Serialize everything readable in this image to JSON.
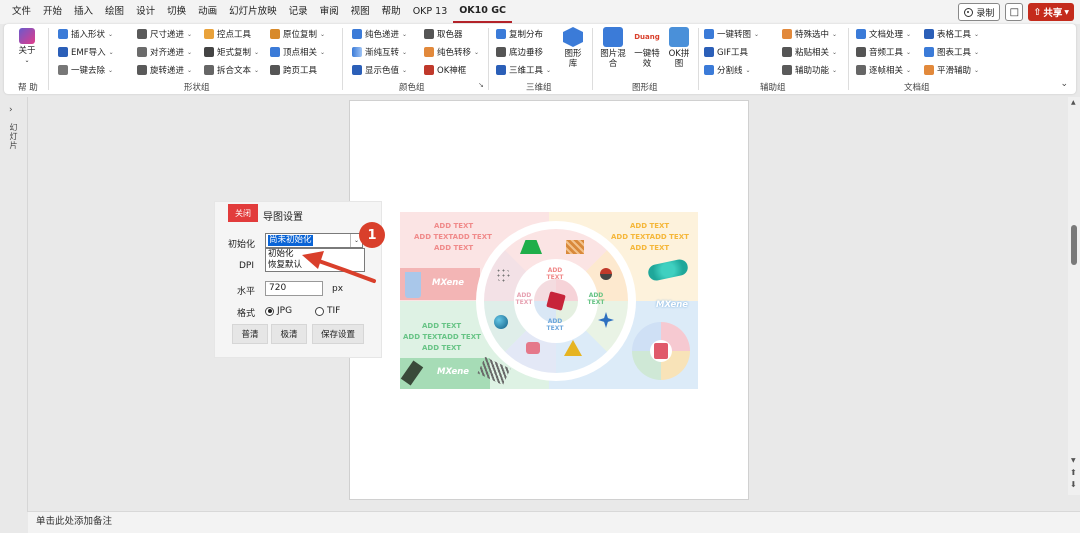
{
  "menubar": {
    "tabs": [
      "文件",
      "开始",
      "插入",
      "绘图",
      "设计",
      "切换",
      "动画",
      "幻灯片放映",
      "记录",
      "审阅",
      "视图",
      "帮助",
      "OKP 13",
      "OK10 GC"
    ],
    "active_tab": "OK10 GC",
    "record_label": "录制",
    "share_label": "共享"
  },
  "ribbon": {
    "help": {
      "about_label": "关于",
      "group_label": "帮 助"
    },
    "shape_group": {
      "label": "形状组",
      "items": [
        "插入形状",
        "尺寸递进",
        "控点工具",
        "原位复制",
        "EMF导入",
        "对齐递进",
        "矩式复制",
        "顶点相关",
        "一键去除",
        "旋转递进",
        "拆合文本",
        "跨页工具"
      ]
    },
    "color_group": {
      "label": "颜色组",
      "items": [
        "纯色递进",
        "取色器",
        "渐纯互转",
        "纯色转移",
        "显示色值",
        "OK神框"
      ]
    },
    "three_d_group": {
      "label": "三维组",
      "items": [
        "复制分布",
        "底边垂移",
        "三维工具"
      ],
      "big_label": "图形库"
    },
    "graphics_group": {
      "label": "图形组",
      "big_buttons": [
        "图片混合",
        "一键特效",
        "OK拼图"
      ],
      "duang_text": "Duang"
    },
    "aux_group": {
      "label": "辅助组",
      "items": [
        "一键转图",
        "特殊选中",
        "GIF工具",
        "粘贴相关",
        "分割线",
        "辅助功能"
      ]
    },
    "doc_group": {
      "label": "文档组",
      "items": [
        "文档处理",
        "表格工具",
        "音频工具",
        "图表工具",
        "逐帧相关",
        "平滑辅助"
      ]
    }
  },
  "left_panel": {
    "label": "幻灯片"
  },
  "dialog": {
    "close_label": "关闭",
    "title": "导图设置",
    "init_label": "初始化",
    "init_value": "尚未初始化",
    "init_options": [
      "初始化",
      "恢复默认"
    ],
    "dpi_label": "DPI",
    "horizontal_label": "水平",
    "horizontal_value": "720",
    "horizontal_unit": "px",
    "format_label": "格式",
    "format_options": [
      "JPG",
      "TIF"
    ],
    "selected_format": "JPG",
    "buttons": [
      "普清",
      "极清",
      "保存设置"
    ]
  },
  "annotation": {
    "badge": "1"
  },
  "infographic": {
    "tl_lines": [
      "ADD TEXT",
      "ADD TEXTADD TEXT",
      "ADD TEXT"
    ],
    "tr_lines": [
      "ADD TEXT",
      "ADD TEXTADD TEXT",
      "ADD TEXT"
    ],
    "bl_lines": [
      "ADD TEXT",
      "ADD TEXTADD TEXT",
      "ADD TEXT"
    ],
    "segment_text": "ADD TEXT",
    "brand": "MXene",
    "colors": {
      "red": "#f08a8a",
      "orange": "#f5b73a",
      "green": "#68c486",
      "blue": "#6fa8dc"
    }
  },
  "notes": {
    "placeholder": "单击此处添加备注"
  }
}
